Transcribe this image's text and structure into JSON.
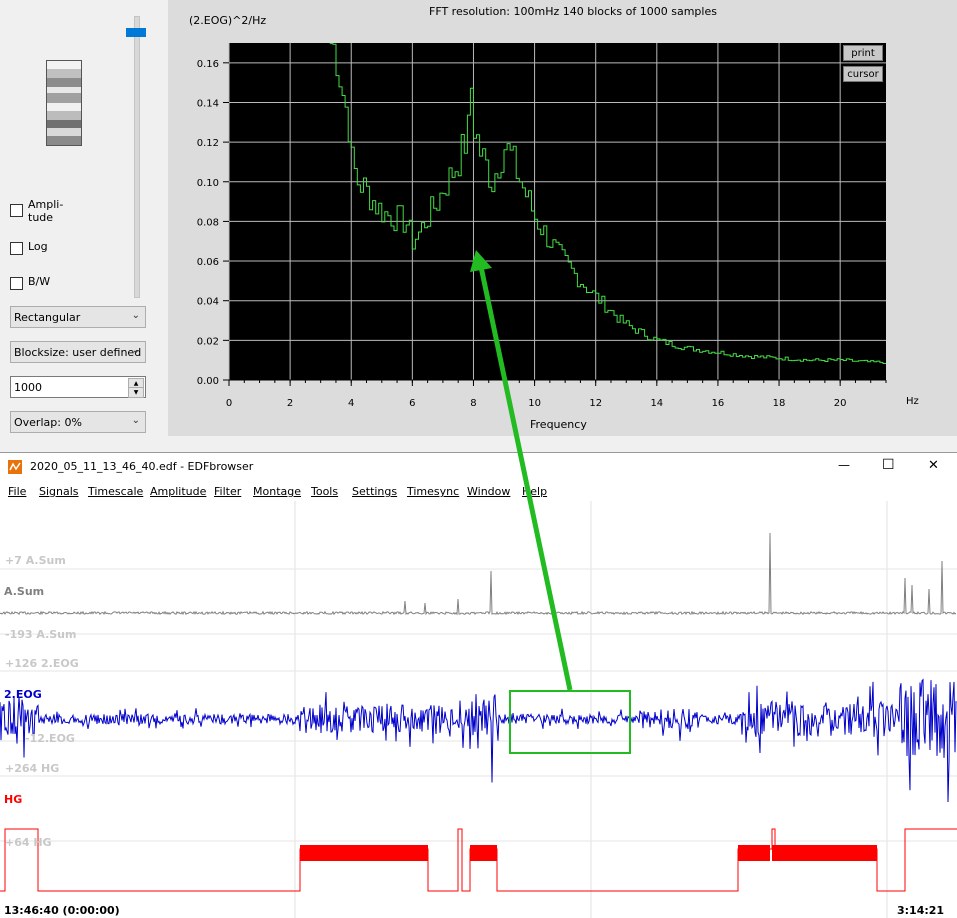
{
  "fft": {
    "title": "FFT resolution: 100mHz   140 blocks of 1000 samples",
    "ylabel": "(2.EOG)^2/Hz",
    "xlabel": "Frequency",
    "xunit": "Hz",
    "print_label": "print",
    "cursor_label": "cursor"
  },
  "controls": {
    "amplitude_label_1": "Ampli-",
    "amplitude_label_2": "tude",
    "log_label": "Log",
    "bw_label": "B/W",
    "window_select": "Rectangular",
    "blocksize_select": "Blocksize: user defined",
    "blocksize_value": "1000",
    "overlap_select": "Overlap: 0%"
  },
  "window": {
    "title": "2020_05_11_13_46_40.edf - EDFbrowser",
    "minimize": "—",
    "maximize": "☐",
    "close": "✕"
  },
  "menu": [
    "File",
    "Signals",
    "Timescale",
    "Amplitude",
    "Filter",
    "Montage",
    "Tools",
    "Settings",
    "Timesync",
    "Window",
    "Help"
  ],
  "signals": {
    "asum": {
      "name": "A.Sum",
      "top_scale": "+7 A.Sum",
      "bottom_scale": "-193 A.Sum",
      "color": "#808080"
    },
    "eog": {
      "name": "2.EOG",
      "top_scale": "+126 2.EOG",
      "bottom_scale": "-12.EOG",
      "color": "#0000cc"
    },
    "hg": {
      "name": "HG",
      "top_scale": "+264 HG",
      "bottom_scale": "+64 HG",
      "color": "#ff0000"
    }
  },
  "timeline": {
    "start": "13:46:40 (0:00:00)",
    "end": "3:14:21"
  },
  "colors": {
    "plot_bg": "#000000",
    "spectrum": "#44dd44",
    "annotation": "#22bb22",
    "accent": "#0078d7"
  },
  "chart_data": {
    "type": "line",
    "title": "FFT resolution: 100mHz   140 blocks of 1000 samples",
    "xlabel": "Frequency",
    "ylabel": "(2.EOG)^2/Hz",
    "xlim": [
      0,
      21.5
    ],
    "ylim": [
      0,
      0.17
    ],
    "x_ticks": [
      0,
      2,
      4,
      6,
      8,
      10,
      12,
      14,
      16,
      18,
      20
    ],
    "y_ticks": [
      0.0,
      0.02,
      0.04,
      0.06,
      0.08,
      0.1,
      0.12,
      0.14,
      0.16
    ],
    "y_tick_labels": [
      "0.00",
      "0.02",
      "0.04",
      "0.06",
      "0.08",
      "0.10",
      "0.12",
      "0.14",
      "0.16"
    ],
    "grid": true,
    "series": [
      {
        "x": [
          3.3,
          3.5,
          3.7,
          3.9,
          4.0,
          4.2,
          4.4,
          4.6,
          4.8,
          5.0,
          5.2,
          5.4,
          5.6,
          5.8,
          6.0,
          6.2,
          6.4,
          6.6,
          6.8,
          7.0,
          7.2,
          7.4,
          7.6,
          7.8,
          7.9,
          8.0,
          8.2,
          8.4,
          8.6,
          8.8,
          9.0,
          9.2,
          9.4,
          9.6,
          9.8,
          10.0,
          10.4,
          10.8,
          11.2,
          11.6,
          12.0,
          12.4,
          12.8,
          13.2,
          13.6,
          14.0,
          14.5,
          15.0,
          15.5,
          16.0,
          16.5,
          17.0,
          18.0,
          19.0,
          20.0,
          21.0,
          21.5
        ],
        "y": [
          0.17,
          0.165,
          0.145,
          0.13,
          0.11,
          0.1,
          0.097,
          0.093,
          0.088,
          0.085,
          0.083,
          0.082,
          0.081,
          0.079,
          0.07,
          0.074,
          0.08,
          0.085,
          0.09,
          0.097,
          0.102,
          0.108,
          0.115,
          0.125,
          0.148,
          0.128,
          0.115,
          0.108,
          0.1,
          0.11,
          0.118,
          0.113,
          0.105,
          0.097,
          0.09,
          0.082,
          0.072,
          0.063,
          0.055,
          0.048,
          0.042,
          0.036,
          0.03,
          0.026,
          0.023,
          0.02,
          0.018,
          0.016,
          0.015,
          0.014,
          0.013,
          0.012,
          0.011,
          0.01,
          0.01,
          0.009,
          0.009
        ]
      }
    ],
    "annotation": {
      "box": "highlighted 2.EOG segment",
      "arrow_to_x": 8.2,
      "arrow_to_y": 0.063
    }
  }
}
